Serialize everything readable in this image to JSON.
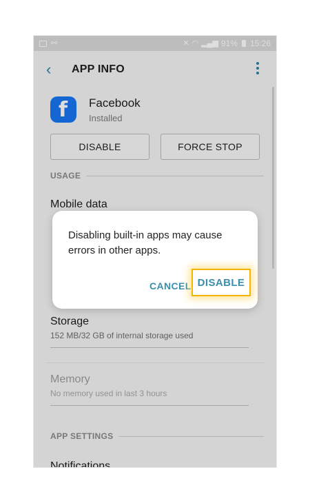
{
  "status_bar": {
    "battery": "91%",
    "time": "15:26"
  },
  "header": {
    "title": "APP INFO"
  },
  "app": {
    "name": "Facebook",
    "status": "Installed"
  },
  "buttons": {
    "disable": "DISABLE",
    "force_stop": "FORCE STOP"
  },
  "sections": {
    "usage": "USAGE",
    "app_settings": "APP SETTINGS"
  },
  "items": {
    "mobile_data": {
      "label": "Mobile data"
    },
    "storage": {
      "label": "Storage",
      "sub": "152 MB/32 GB of internal storage used"
    },
    "memory": {
      "label": "Memory",
      "sub": "No memory used in last 3 hours"
    },
    "notifications": {
      "label": "Notifications"
    }
  },
  "dialog": {
    "message": "Disabling built-in apps may cause errors in other apps.",
    "cancel": "CANCEL",
    "confirm": "DISABLE",
    "highlight_color": "#f4b400",
    "accent_color": "#3a8fad"
  },
  "icons": {
    "back": "back-arrow-icon",
    "more": "more-vertical-icon",
    "app": "facebook-icon"
  }
}
